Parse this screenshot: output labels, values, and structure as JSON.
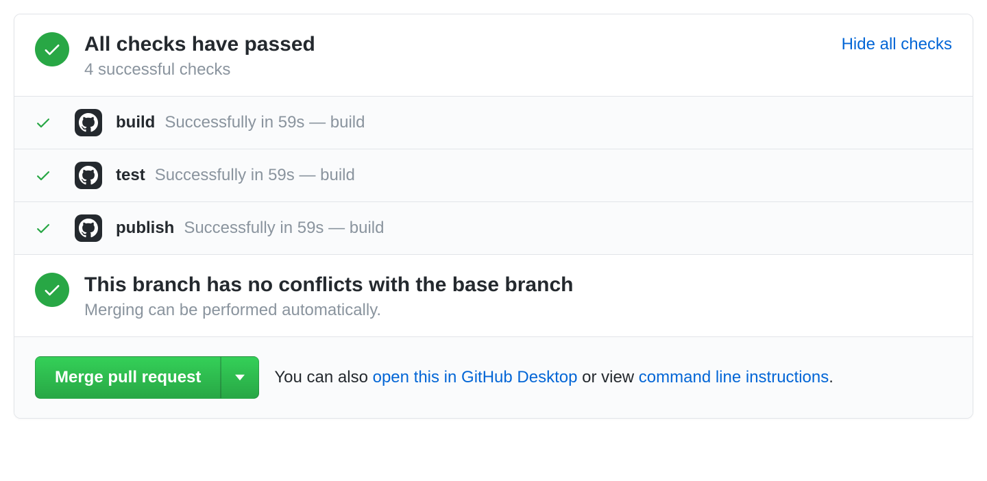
{
  "checks_header": {
    "title": "All checks have passed",
    "subtitle": "4 successful checks",
    "toggle_link": "Hide all checks"
  },
  "checks": [
    {
      "name": "build",
      "detail": "Successfully in 59s — build"
    },
    {
      "name": "test",
      "detail": "Successfully in 59s — build"
    },
    {
      "name": "publish",
      "detail": "Successfully in 59s — build"
    }
  ],
  "conflicts": {
    "title": "This branch has no conflicts with the base branch",
    "subtitle": "Merging can be performed automatically."
  },
  "merge": {
    "button_label": "Merge pull request",
    "footer_prefix": "You can also ",
    "desktop_link": "open this in GitHub Desktop",
    "middle": " or view ",
    "cli_link": "command line instructions",
    "suffix": "."
  }
}
